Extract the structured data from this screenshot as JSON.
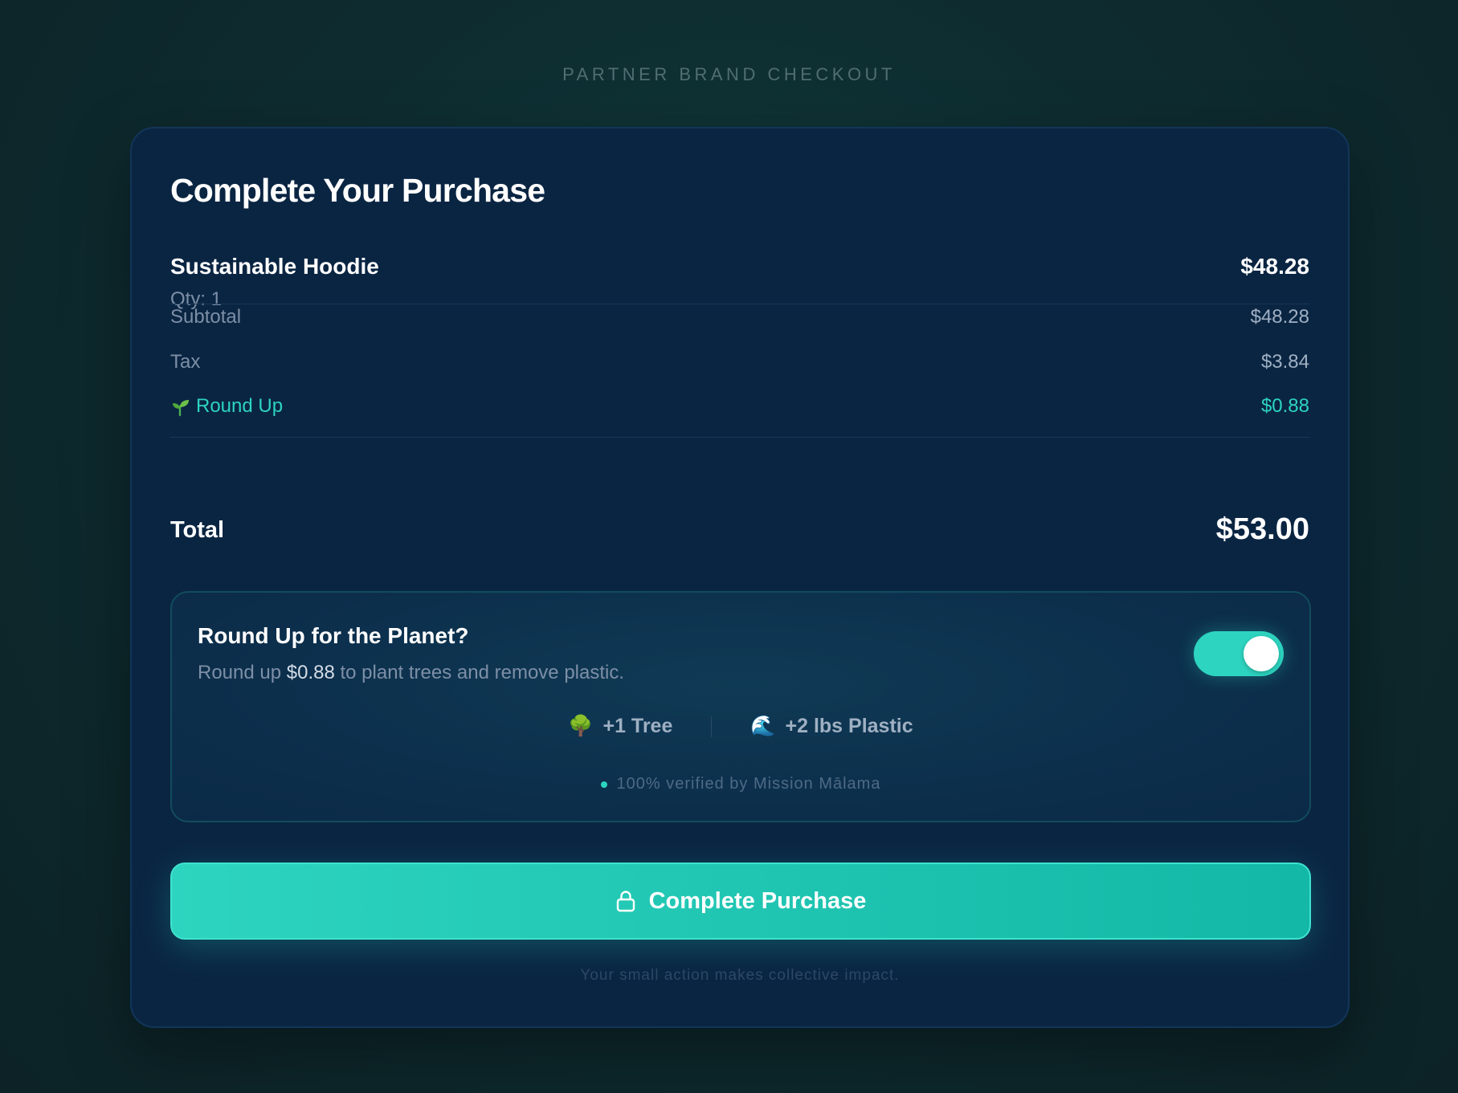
{
  "page": {
    "brand_label": "PARTNER BRAND CHECKOUT"
  },
  "checkout": {
    "title": "Complete Your Purchase",
    "item": {
      "name": "Sustainable Hoodie",
      "qty_label": "Qty: 1",
      "price": "$48.28"
    },
    "summary": {
      "subtotal_label": "Subtotal",
      "subtotal_value": "$48.28",
      "tax_label": "Tax",
      "tax_value": "$3.84",
      "roundup_label": "Round Up",
      "roundup_value": "$0.88"
    },
    "total": {
      "label": "Total",
      "value": "$53.00"
    }
  },
  "roundup_panel": {
    "title": "Round Up for the Planet?",
    "desc_prefix": "Round up ",
    "desc_amount": "$0.88",
    "desc_suffix": " to plant trees and remove plastic.",
    "toggle_on": true,
    "impact": [
      {
        "icon": "tree-icon",
        "glyph": "🌳",
        "label": "+1 Tree"
      },
      {
        "icon": "wave-icon",
        "glyph": "🌊",
        "label": "+2 lbs Plastic"
      }
    ],
    "verified_text": "100% verified by Mission Mālama"
  },
  "cta": {
    "label": "Complete Purchase",
    "icon": "lock-icon"
  },
  "footer_note": "Your small action makes collective impact.",
  "colors": {
    "accent": "#2dd4bf",
    "card_bg": "#0a2542",
    "page_bg": "#0e2c30"
  }
}
